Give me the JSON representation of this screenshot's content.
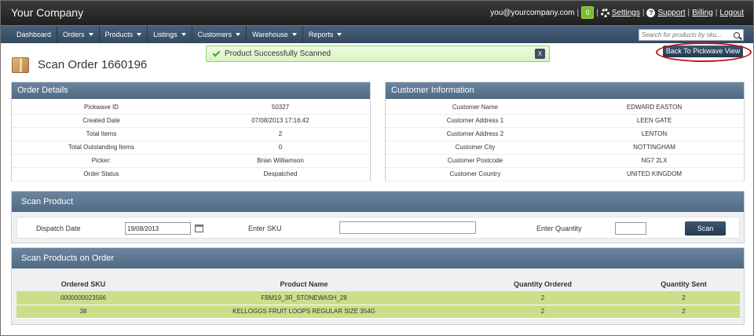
{
  "header": {
    "brand": "Your Company",
    "email": "you@yourcompany.com",
    "notification_count": "0",
    "settings": "Settings",
    "support": "Support",
    "billing": "Billing",
    "logout": "Logout"
  },
  "nav": {
    "items": [
      "Dashboard",
      "Orders",
      "Products",
      "Listings",
      "Customers",
      "Warehouse",
      "Reports"
    ],
    "search_placeholder": "Search for products by sku..."
  },
  "page": {
    "title": "Scan Order 1660196",
    "alert": "Product Successfully Scanned",
    "alert_close": "X",
    "back_button": "Back To Pickwave View"
  },
  "order_details": {
    "title": "Order Details",
    "rows": [
      {
        "key": "Pickwave ID",
        "value": "50327"
      },
      {
        "key": "Created Date",
        "value": "07/08/2013 17:16:42"
      },
      {
        "key": "Total Items",
        "value": "2"
      },
      {
        "key": "Total Outstanding Items",
        "value": "0"
      },
      {
        "key": "Picker:",
        "value": "Brian Williamson"
      },
      {
        "key": "Order Status",
        "value": "Despatched"
      }
    ]
  },
  "customer_info": {
    "title": "Customer Information",
    "rows": [
      {
        "key": "Customer Name",
        "value": "EDWARD EASTON"
      },
      {
        "key": "Customer Address 1",
        "value": "LEEN GATE"
      },
      {
        "key": "Customer Address 2",
        "value": "LENTON"
      },
      {
        "key": "Customer City",
        "value": "NOTTINGHAM"
      },
      {
        "key": "Customer Postcode",
        "value": "NG7 2LX"
      },
      {
        "key": "Customer Country",
        "value": "UNITED KINGDOM"
      }
    ]
  },
  "scan_product": {
    "title": "Scan Product",
    "dispatch_date_label": "Dispatch Date",
    "dispatch_date_value": "19/08/2013",
    "sku_label": "Enter SKU",
    "sku_value": "",
    "quantity_label": "Enter Quantity",
    "quantity_value": "",
    "scan_button": "Scan"
  },
  "scanned_products": {
    "title": "Scan Products on Order",
    "columns": [
      "Ordered SKU",
      "Product Name",
      "Quantity Ordered",
      "Quantity Sent"
    ],
    "rows": [
      [
        "0000000023566",
        "FBM19_3R_STONEWASH_28",
        "2",
        "2"
      ],
      [
        "38",
        "KELLOGGS FRUIT LOOPS REGULAR SIZE 354G",
        "2",
        "2"
      ]
    ]
  }
}
